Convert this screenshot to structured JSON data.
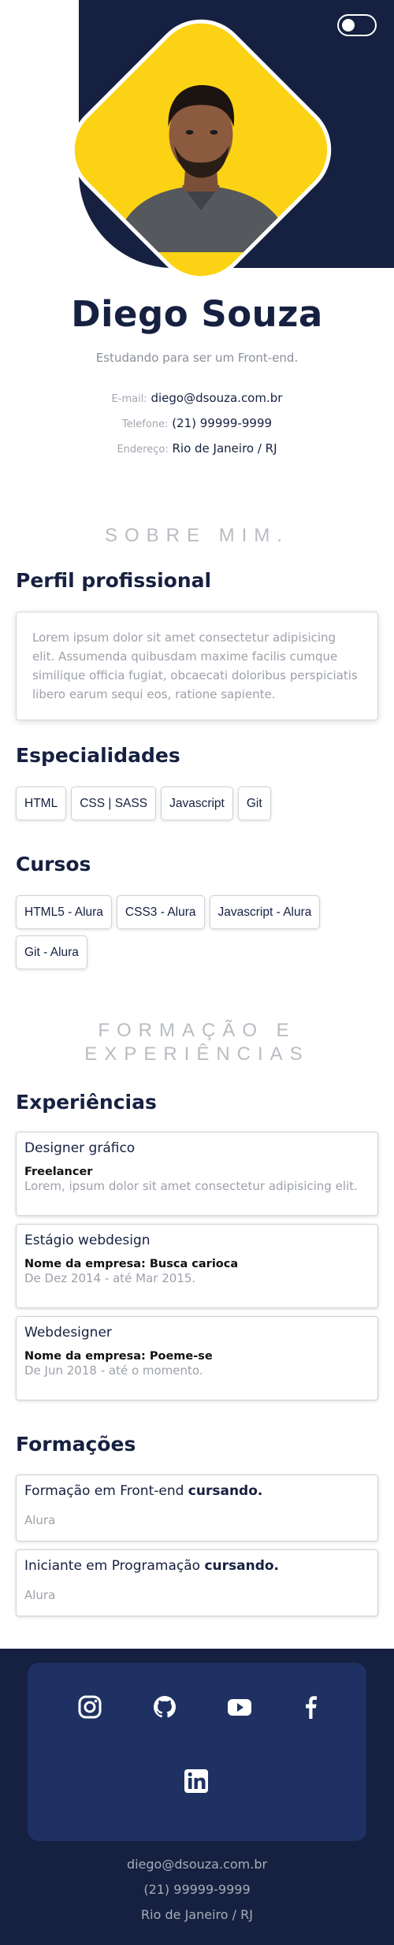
{
  "profile": {
    "name": "Diego Souza",
    "subtitle": "Estudando para ser um Front-end.",
    "contacts": [
      {
        "label": "E-mail:",
        "value": "diego@dsouza.com.br"
      },
      {
        "label": "Telefone:",
        "value": "(21) 99999-9999"
      },
      {
        "label": "Endereço:",
        "value": "Rio de Janeiro / RJ"
      }
    ]
  },
  "about": {
    "heading": "SOBRE MIM.",
    "profile_title": "Perfil profissional",
    "profile_text": "Lorem ipsum dolor sit amet consectetur adipisicing elit. Assumenda quibusdam maxime facilis cumque similique officia fugiat, obcaecati doloribus perspiciatis libero earum sequi eos, ratione sapiente.",
    "skills_title": "Especialidades",
    "skills": [
      "HTML",
      "CSS | SASS",
      "Javascript",
      "Git"
    ],
    "courses_title": "Cursos",
    "courses": [
      "HTML5 - Alura",
      "CSS3 - Alura",
      "Javascript - Alura",
      "Git - Alura"
    ]
  },
  "experience": {
    "heading_line1": "FORMAÇÃO E",
    "heading_line2": "EXPERIÊNCIAS",
    "experiences_title": "Experiências",
    "experiences": [
      {
        "role": "Designer gráfico",
        "company": "Freelancer",
        "detail": "Lorem, ipsum dolor sit amet consectetur adipisicing elit."
      },
      {
        "role": "Estágio webdesign",
        "company": "Nome da empresa: Busca carioca",
        "detail": "De Dez 2014 - até Mar 2015."
      },
      {
        "role": "Webdesigner",
        "company": "Nome da empresa: Poeme-se",
        "detail": "De Jun 2018 - até o momento."
      }
    ],
    "education_title": "Formações",
    "education": [
      {
        "course": "Formação em Front-end",
        "status": "cursando.",
        "school": "Alura"
      },
      {
        "course": "Iniciante em Programação",
        "status": "cursando.",
        "school": "Alura"
      }
    ]
  },
  "footer": {
    "social_icons": [
      "instagram-icon",
      "github-icon",
      "youtube-icon",
      "facebook-icon",
      "linkedin-icon"
    ],
    "email": "diego@dsouza.com.br",
    "phone": "(21) 99999-9999",
    "address": "Rio de Janeiro / RJ"
  },
  "colors": {
    "navy": "#162040",
    "accent_yellow": "#fcd314",
    "social_box": "#1e3162",
    "muted_text": "#9da1a9"
  }
}
